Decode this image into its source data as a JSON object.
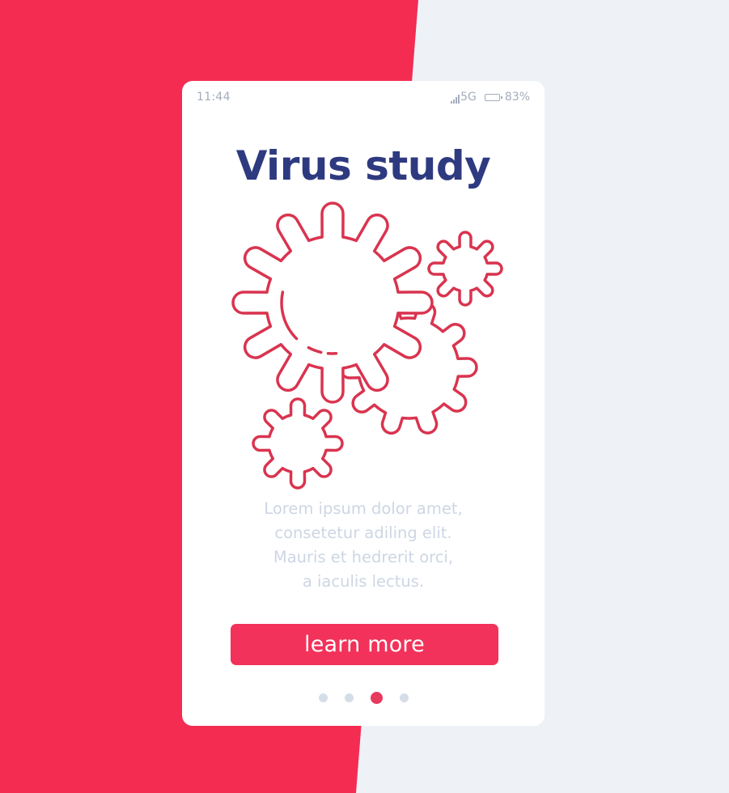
{
  "status_bar": {
    "time": "11:44",
    "network": "5G",
    "battery_percent": "83%",
    "battery_level": 0.83,
    "icons": [
      "signal-icon",
      "battery-icon"
    ]
  },
  "screen": {
    "title": "Virus study",
    "illustration": "virus-cells-illustration",
    "body_lines": [
      "Lorem ipsum dolor amet,",
      "consetetur adiling elit.",
      "Mauris et hedrerit orci,",
      "a iaculis lectus."
    ],
    "cta_label": "learn more"
  },
  "pagination": {
    "total": 4,
    "active_index": 2
  },
  "colors": {
    "background_red": "#F42C52",
    "background_gray": "#EEF2F7",
    "title": "#2E3A80",
    "accent": "#F2325A",
    "illustration_stroke": "#D9344F",
    "muted_text": "#CDD6E4",
    "status_text": "#A3ACBC"
  }
}
